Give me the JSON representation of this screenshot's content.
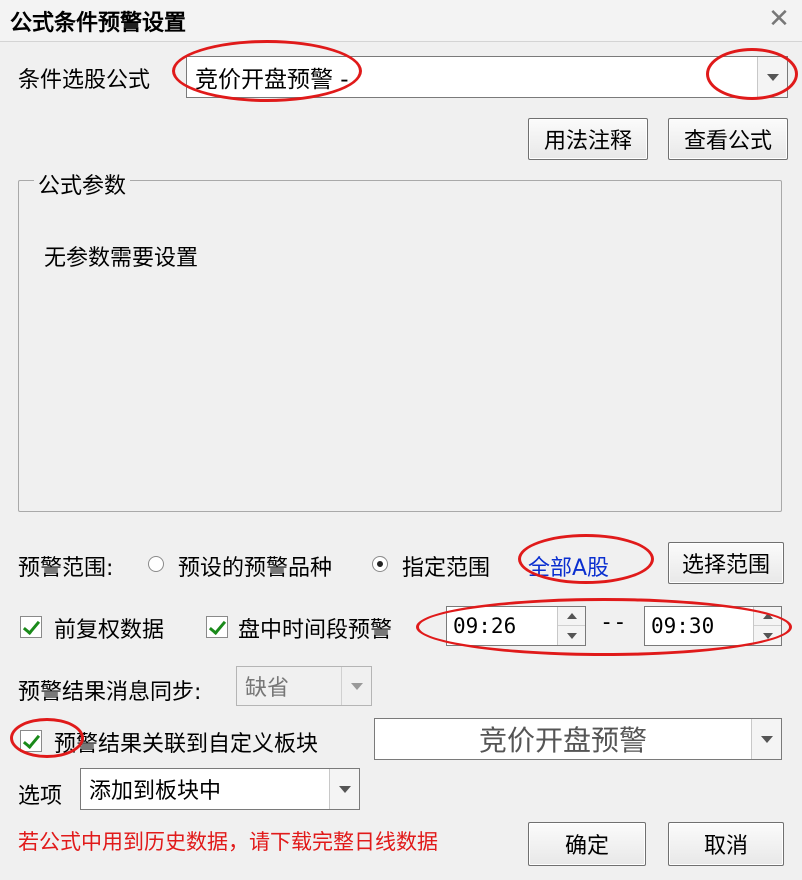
{
  "window": {
    "title": "公式条件预警设置"
  },
  "formula": {
    "label": "条件选股公式",
    "value": "竞价开盘预警 -"
  },
  "buttons": {
    "usage_notes": "用法注释",
    "view_formula": "查看公式",
    "select_range": "选择范围",
    "ok": "确定",
    "cancel": "取消"
  },
  "params": {
    "legend": "公式参数",
    "message": "无参数需要设置"
  },
  "scope": {
    "label": "预警范围:",
    "option_preset": "预设的预警品种",
    "option_range": "指定范围",
    "selected": "option_range",
    "range_link": "全部A股"
  },
  "options": {
    "forward_adjust_label": "前复权数据",
    "forward_adjust_checked": true,
    "intraday_label": "盘中时间段预警",
    "intraday_checked": true,
    "time_start": "09:26",
    "time_separator": "--",
    "time_end": "09:30"
  },
  "sync": {
    "label": "预警结果消息同步:",
    "value": "缺省"
  },
  "link_block": {
    "label": "预警结果关联到自定义板块",
    "checked": true,
    "value": "竞价开盘预警"
  },
  "option_select": {
    "label": "选项",
    "value": "添加到板块中"
  },
  "warning": "若公式中用到历史数据，请下载完整日线数据",
  "colors": {
    "window_bg": "#f0f0f0",
    "link": "#0a2fd0",
    "warning": "#e11a1a",
    "annotation": "#e01a1a"
  }
}
